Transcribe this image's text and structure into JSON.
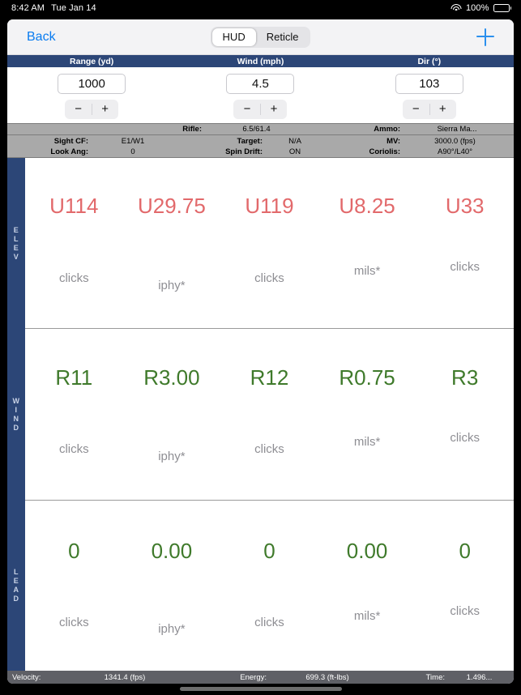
{
  "status_bar": {
    "time": "8:42 AM",
    "date": "Tue Jan 14",
    "battery_percent": "100%",
    "wifi_icon": "wifi-icon",
    "battery_icon": "battery-icon"
  },
  "navbar": {
    "back_label": "Back",
    "add_icon": "plus-icon",
    "segments": [
      {
        "label": "HUD",
        "selected": true
      },
      {
        "label": "Reticle",
        "selected": false
      }
    ]
  },
  "inputs": {
    "columns": [
      {
        "header": "Range (yd)",
        "value": "1000",
        "minus": "−",
        "plus": "+"
      },
      {
        "header": "Wind (mph)",
        "value": "4.5",
        "minus": "−",
        "plus": "+"
      },
      {
        "header": "Dir (°)",
        "value": "103",
        "minus": "−",
        "plus": "+"
      }
    ]
  },
  "info": {
    "row1": [
      {
        "label": "Rifle:",
        "value": "6.5/61.4"
      },
      {
        "label": "Ammo:",
        "value": "Sierra Ma..."
      }
    ],
    "row2": [
      {
        "label": "Sight CF:",
        "value": "E1/W1"
      },
      {
        "label": "Target:",
        "value": "N/A"
      },
      {
        "label": "MV:",
        "value": "3000.0 (fps)"
      }
    ],
    "row3": [
      {
        "label": "Look Ang:",
        "value": "0"
      },
      {
        "label": "Spin Drift:",
        "value": "ON"
      },
      {
        "label": "Coriolis:",
        "value": "A90°/L40°"
      }
    ]
  },
  "hud": {
    "rows": [
      {
        "name": "ELEV",
        "rail_letters": "E\nL\nE\nV",
        "color": "#e2696b",
        "cells": [
          {
            "value": "U114",
            "unit": "clicks"
          },
          {
            "value": "U29.75",
            "unit": "iphy*"
          },
          {
            "value": "U119",
            "unit": "clicks"
          },
          {
            "value": "U8.25",
            "unit": "mils*"
          },
          {
            "value": "U33",
            "unit": "clicks"
          }
        ]
      },
      {
        "name": "WIND",
        "rail_letters": "W\nI\nN\nD",
        "color": "#3f7a2b",
        "cells": [
          {
            "value": "R11",
            "unit": "clicks"
          },
          {
            "value": "R3.00",
            "unit": "iphy*"
          },
          {
            "value": "R12",
            "unit": "clicks"
          },
          {
            "value": "R0.75",
            "unit": "mils*"
          },
          {
            "value": "R3",
            "unit": "clicks"
          }
        ]
      },
      {
        "name": "LEAD",
        "rail_letters": "L\nE\nA\nD",
        "color": "#3f7a2b",
        "cells": [
          {
            "value": "0",
            "unit": "clicks"
          },
          {
            "value": "0.00",
            "unit": "iphy*"
          },
          {
            "value": "0",
            "unit": "clicks"
          },
          {
            "value": "0.00",
            "unit": "mils*"
          },
          {
            "value": "0",
            "unit": "clicks"
          }
        ]
      }
    ]
  },
  "bottom_bar": {
    "velocity_label": "Velocity:",
    "velocity_value": "1341.4 (fps)",
    "energy_label": "Energy:",
    "energy_value": "699.3 (ft-lbs)",
    "time_label": "Time:",
    "time_value": "1.496..."
  }
}
